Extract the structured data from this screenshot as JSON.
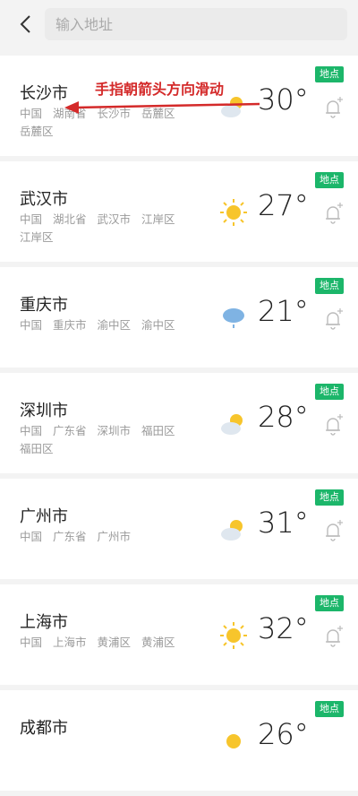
{
  "search": {
    "placeholder": "输入地址"
  },
  "badge_label": "地点",
  "annotation": "手指朝箭头方向滑动",
  "colors": {
    "badge": "#1cb66a",
    "annotation": "#d42a2a",
    "sun": "#f7c52c"
  },
  "cities": [
    {
      "name": "长沙市",
      "address": [
        "中国",
        "湖南省",
        "长沙市",
        "岳麓区",
        "岳麓区"
      ],
      "temp": "30°",
      "icon": "partly-cloudy-icon"
    },
    {
      "name": "武汉市",
      "address": [
        "中国",
        "湖北省",
        "武汉市",
        "江岸区",
        "江岸区"
      ],
      "temp": "27°",
      "icon": "sunny-icon"
    },
    {
      "name": "重庆市",
      "address": [
        "中国",
        "重庆市",
        "渝中区",
        "渝中区"
      ],
      "temp": "21°",
      "icon": "rain-icon"
    },
    {
      "name": "深圳市",
      "address": [
        "中国",
        "广东省",
        "深圳市",
        "福田区",
        "福田区"
      ],
      "temp": "28°",
      "icon": "partly-cloudy-icon"
    },
    {
      "name": "广州市",
      "address": [
        "中国",
        "广东省",
        "广州市"
      ],
      "temp": "31°",
      "icon": "partly-cloudy-icon"
    },
    {
      "name": "上海市",
      "address": [
        "中国",
        "上海市",
        "黄浦区",
        "黄浦区"
      ],
      "temp": "32°",
      "icon": "sunny-icon"
    },
    {
      "name": "成都市",
      "address": [],
      "temp": "26°",
      "icon": "sunny-icon"
    }
  ]
}
